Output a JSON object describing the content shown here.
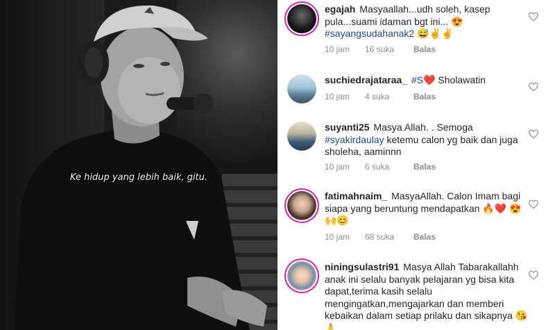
{
  "video": {
    "subtitle": "Ke hidup yang lebih baik, gitu."
  },
  "comments": [
    {
      "username": "egajah",
      "text_parts": [
        {
          "t": "Masyaallah...udh soleh, kasep pula...suami idaman bgt ini... 😍 ",
          "tag": false
        },
        {
          "t": "#sayangsudahanak2",
          "tag": true
        },
        {
          "t": " 😅✌️✌️",
          "tag": false
        }
      ],
      "time": "10 jam",
      "likes": "16 suka",
      "reply": "Balas"
    },
    {
      "username": "suchiedrajataraa_",
      "text_parts": [
        {
          "t": "#S",
          "tag": true
        },
        {
          "t": "❤️ Sholawatin",
          "tag": false
        }
      ],
      "time": "10 jam",
      "likes": "4 suka",
      "reply": "Balas"
    },
    {
      "username": "suyanti25",
      "text_parts": [
        {
          "t": "Masya Allah. . Semoga ",
          "tag": false
        },
        {
          "t": "#syakirdaulay",
          "tag": true
        },
        {
          "t": " ketemu calon yg baik dan juga sholeha, aaminnn",
          "tag": false
        }
      ],
      "time": "10 jam",
      "likes": "6 suka",
      "reply": "Balas"
    },
    {
      "username": "fatimahnaim_",
      "text_parts": [
        {
          "t": "MasyaAllah. Calon Imam bagi siapa yang beruntung mendapatkan 🔥❤️ 😍🙌😊",
          "tag": false
        }
      ],
      "time": "10 jam",
      "likes": "68 suka",
      "reply": "Balas"
    },
    {
      "username": "niningsulastri91",
      "text_parts": [
        {
          "t": "Masya Allah Tabarakallahh anak ini selalu banyak pelajaran yg bisa kita dapat,terima kasih selalu mengingatkan,mengajarkan dan memberi kebaikan dalam setiap prilaku dan sikapnya 😘🙏",
          "tag": false
        }
      ],
      "time": "",
      "likes": "",
      "reply": ""
    }
  ],
  "icons": {
    "heart": "heart-outline-icon"
  },
  "colors": {
    "hashtag": "#1e4a86",
    "meta": "#8e8e8e",
    "story_ring": "#d6249f"
  }
}
